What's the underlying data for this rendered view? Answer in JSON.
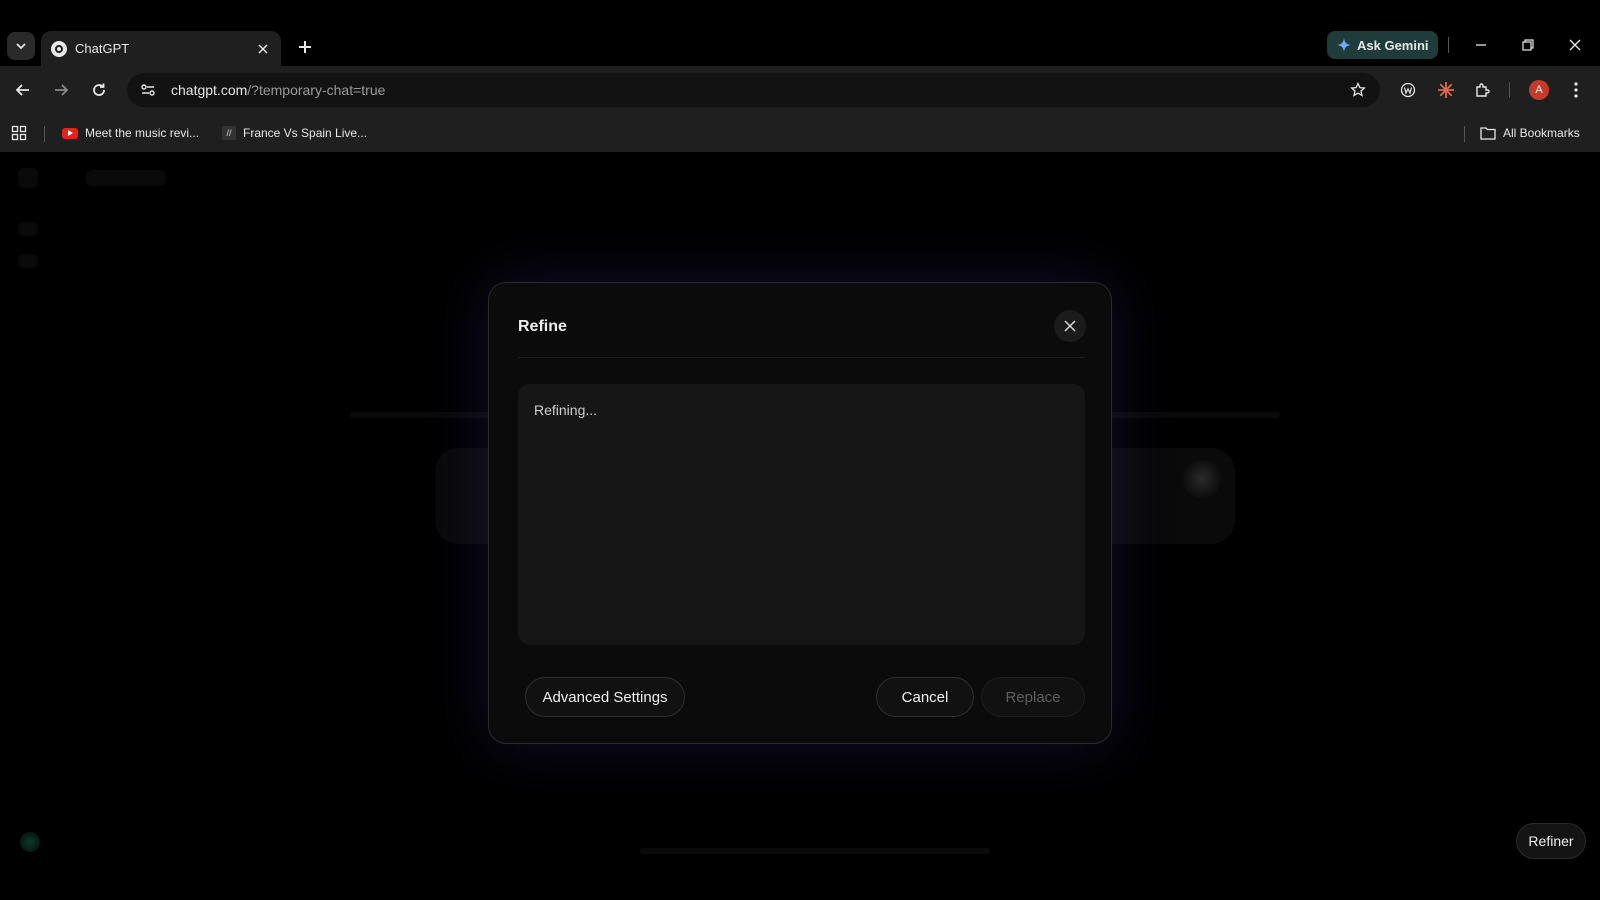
{
  "browser": {
    "tab_title": "ChatGPT",
    "gemini_label": "Ask Gemini",
    "url_host": "chatgpt.com",
    "url_path": "/?temporary-chat=true",
    "avatar_letter": "A",
    "bookmarks": [
      {
        "label": "Meet the music revi...",
        "icon": "youtube-icon"
      },
      {
        "label": "France Vs Spain Live...",
        "icon": "site-icon"
      }
    ],
    "all_bookmarks_label": "All Bookmarks"
  },
  "modal": {
    "title": "Refine",
    "status_text": "Refining...",
    "advanced_settings_label": "Advanced Settings",
    "cancel_label": "Cancel",
    "replace_label": "Replace"
  },
  "page": {
    "refiner_label": "Refiner"
  },
  "colors": {
    "accent_glow": "#463caa",
    "gemini_bg": "#1f3b3a",
    "avatar_bg": "#c53b2b"
  }
}
